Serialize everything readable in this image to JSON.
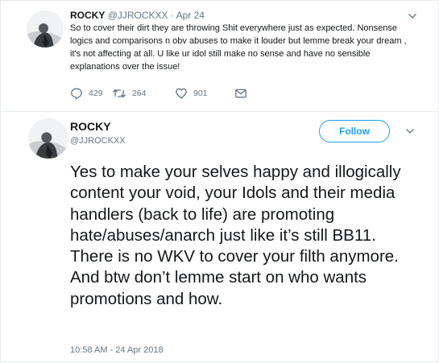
{
  "reply_tweet": {
    "name": "ROCKY",
    "handle": "@JJROCKXX",
    "separator": "·",
    "date": "Apr 24",
    "text": "So to cover their dirt they are throwing Shit everywhere just as expected. Nonsense logics and comparisons n obv abuses to make it louder but lemme break your dream , it's not affecting at all. U like ur idol still make no sense and have no sensible explanations over the issue!",
    "actions": {
      "reply_icon": "reply-icon",
      "reply_count": "429",
      "retweet_icon": "retweet-icon",
      "retweet_count": "264",
      "like_icon": "heart-icon",
      "like_count": "901",
      "dm_icon": "envelope-icon"
    }
  },
  "main_tweet": {
    "name": "ROCKY",
    "handle": "@JJROCKXX",
    "follow_label": "Follow",
    "text": "Yes to make your selves happy and illogically content your void, your Idols and their media handlers (back to life) are promoting hate/abuses/anarch just like it’s still BB11. There is no WKV to cover your filth anymore. And btw don’t lemme start on who wants promotions and how.",
    "timestamp": "10:58 AM - 24 Apr 2018"
  },
  "colors": {
    "accent": "#1da1f2",
    "secondary_text": "#657786",
    "primary_text": "#14171a",
    "divider": "#e6ecf0"
  }
}
